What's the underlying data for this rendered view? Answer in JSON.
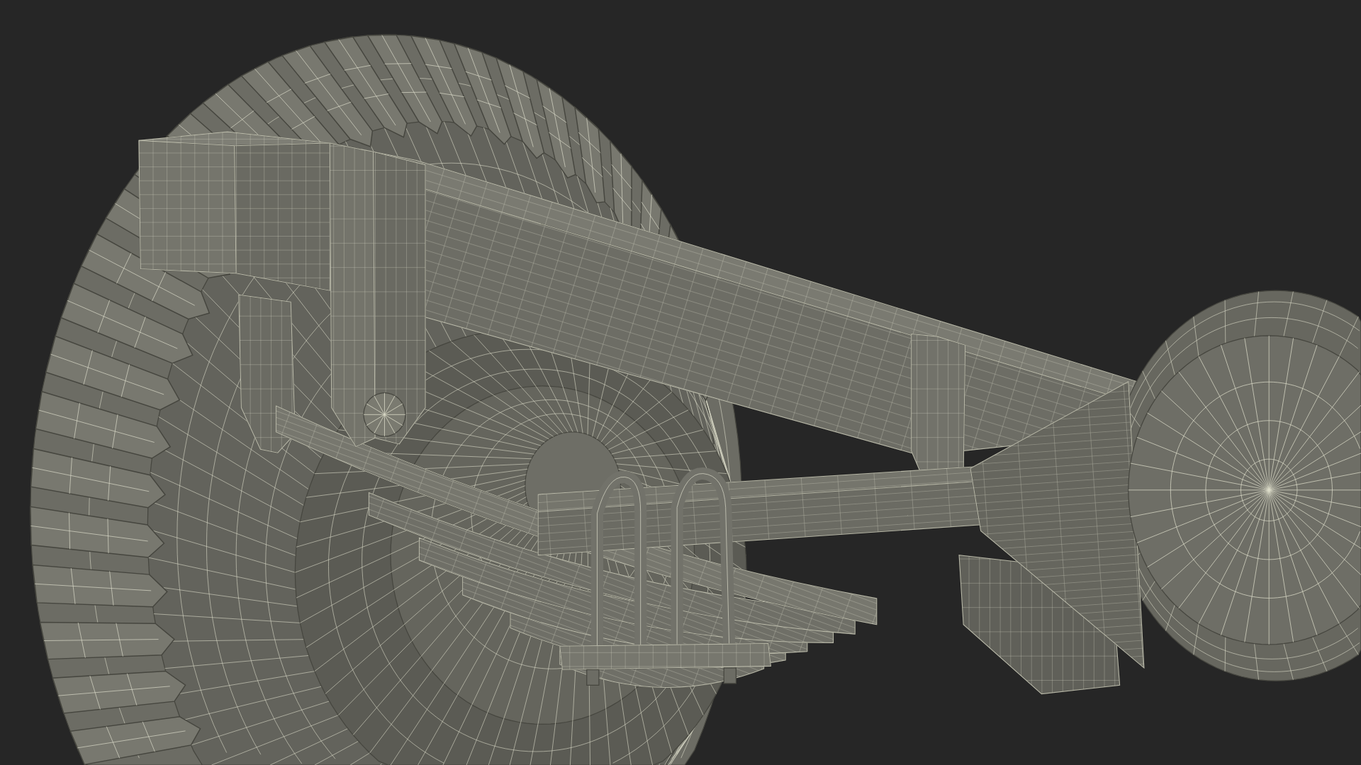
{
  "viewport": {
    "wireframe": true
  }
}
